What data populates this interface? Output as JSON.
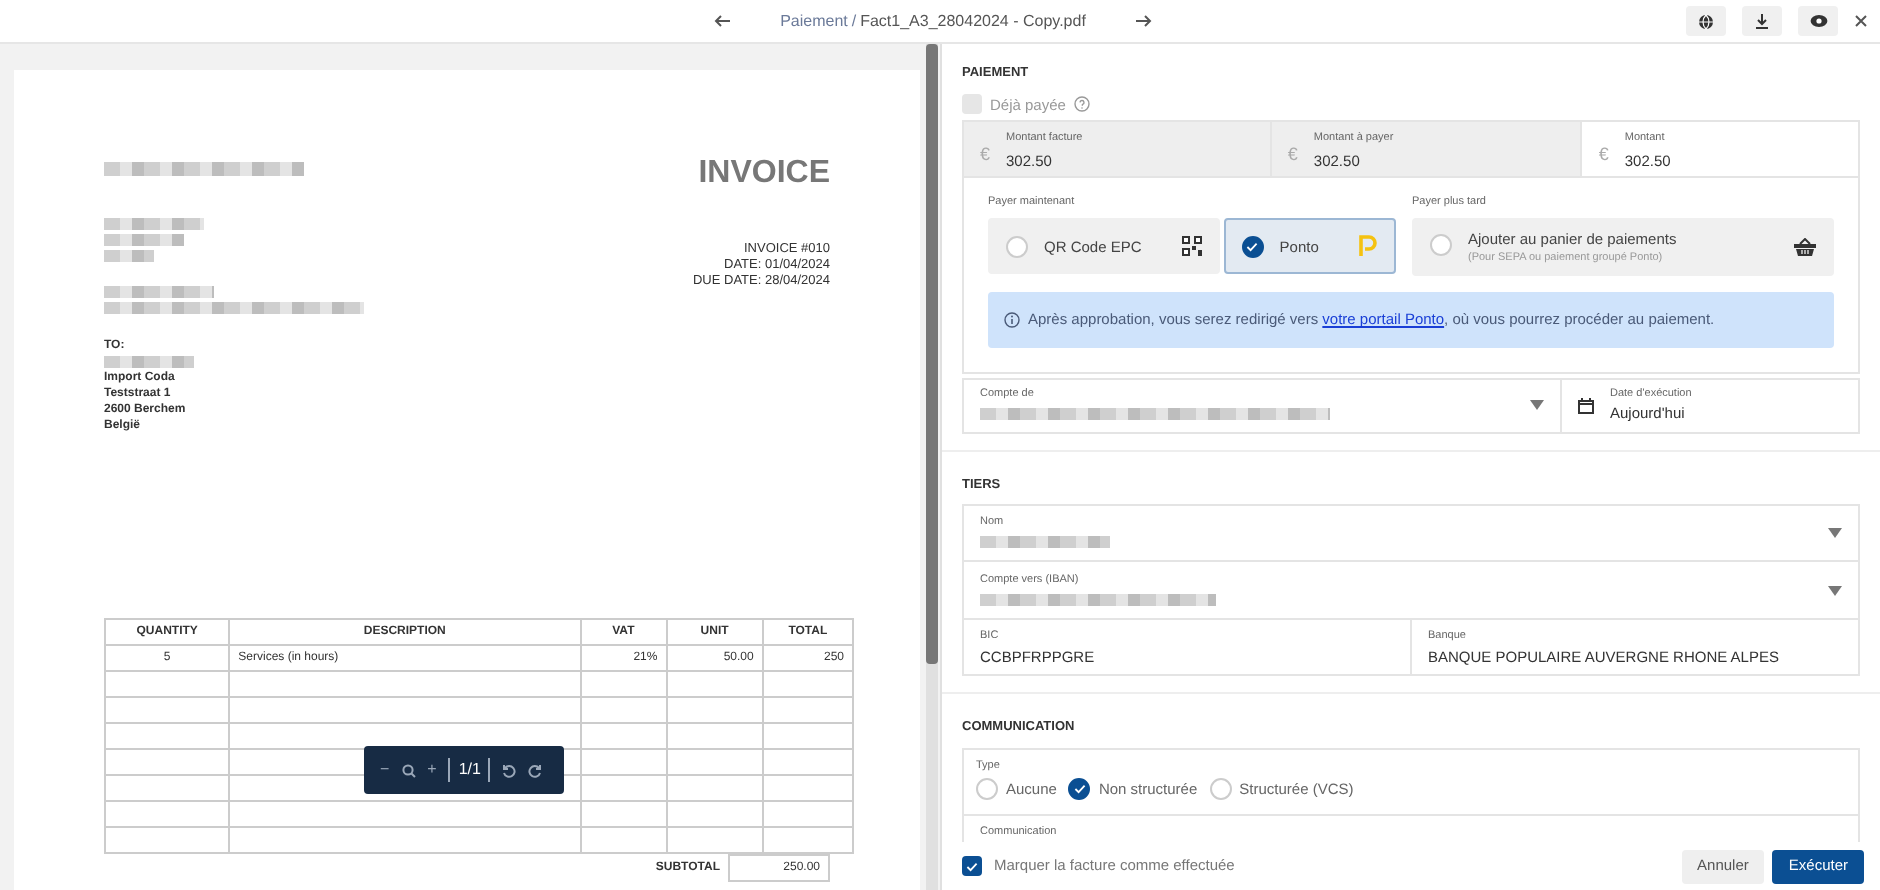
{
  "topbar": {
    "section": "Paiement",
    "separator": "/",
    "file": "Fact1_A3_28042024 - Copy.pdf"
  },
  "invoice": {
    "title": "INVOICE",
    "meta": [
      "INVOICE #010",
      "DATE: 01/04/2024",
      "DUE DATE: 28/04/2024"
    ],
    "to_label": "TO:",
    "to_lines": [
      "Import Coda",
      "Teststraat 1",
      "2600 Berchem",
      "België"
    ],
    "columns": [
      "QUANTITY",
      "DESCRIPTION",
      "VAT",
      "UNIT",
      "TOTAL"
    ],
    "rows": [
      [
        "5",
        "Services (in hours)",
        "21%",
        "50.00",
        "250"
      ]
    ],
    "subtotal": {
      "label": "SUBTOTAL",
      "value": "250.00"
    }
  },
  "viewer_toolbar": {
    "minus": "−",
    "plus": "+",
    "page": "1/1"
  },
  "payment": {
    "title": "PAIEMENT",
    "already_paid": {
      "label": "Déjà payée",
      "checked": false,
      "disabled": true
    },
    "amounts": [
      {
        "label": "Montant facture",
        "currency": "€",
        "value": "302.50",
        "readonly": true
      },
      {
        "label": "Montant à payer",
        "currency": "€",
        "value": "302.50",
        "readonly": true
      },
      {
        "label": "Montant",
        "currency": "€",
        "value": "302.50",
        "readonly": false
      }
    ],
    "pay_now": {
      "label": "Payer maintenant",
      "options": [
        {
          "label": "QR Code EPC",
          "kind": "qr",
          "selected": false
        },
        {
          "label": "Ponto",
          "kind": "ponto",
          "selected": true
        }
      ]
    },
    "pay_later": {
      "label": "Payer plus tard",
      "option": {
        "label": "Ajouter au panier de paiements",
        "hint": "(Pour SEPA ou paiement groupé Ponto)",
        "selected": false
      }
    },
    "info": {
      "before": "Après approbation, vous serez redirigé vers ",
      "link": "votre portail Ponto",
      "after": ", où vous pourrez procéder au paiement."
    },
    "account": {
      "label": "Compte de"
    },
    "date": {
      "label": "Date d'exécution",
      "value": "Aujourd'hui"
    }
  },
  "tiers": {
    "title": "TIERS",
    "name": {
      "label": "Nom"
    },
    "iban": {
      "label": "Compte vers (IBAN)"
    },
    "bic": {
      "label": "BIC",
      "value": "CCBPFRPPGRE"
    },
    "bank": {
      "label": "Banque",
      "value": "BANQUE POPULAIRE AUVERGNE RHONE ALPES"
    }
  },
  "communication": {
    "title": "COMMUNICATION",
    "type_label": "Type",
    "options": [
      {
        "label": "Aucune",
        "selected": false
      },
      {
        "label": "Non structurée",
        "selected": true
      },
      {
        "label": "Structurée (VCS)",
        "selected": false
      }
    ],
    "field_label": "Communication"
  },
  "footer": {
    "mark_done": {
      "label": "Marquer la facture comme effectuée",
      "checked": true
    },
    "buttons": [
      {
        "label": "Annuler",
        "kind": "secondary"
      },
      {
        "label": "Exécuter",
        "kind": "primary"
      }
    ]
  }
}
